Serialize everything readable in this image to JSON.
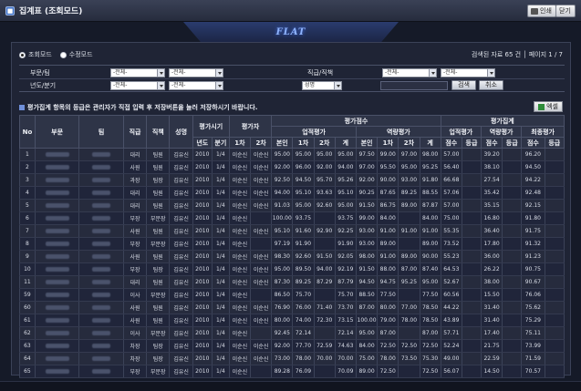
{
  "window": {
    "title": "집계표 (조회모드)",
    "print_label": "인쇄",
    "close_label": "닫기"
  },
  "logo_text": "FLAT",
  "mode": {
    "view_label": "조회모드",
    "edit_label": "수정모드",
    "selected": "view"
  },
  "paging": {
    "text": "검색된 자료 65 건 │ 페이지 1 / 7"
  },
  "filters": {
    "dept_label": "부문/팀",
    "dept_value": "-전체-",
    "team_value": "-전체-",
    "rank_label": "직급/직책",
    "rank_value": "-전체-",
    "position_value": "-전체-",
    "year_label": "년도/분기",
    "year_value": "-전체-",
    "quarter_value": "-전체-",
    "name_value": "성명",
    "search_label": "검색",
    "cancel_label": "취소"
  },
  "notice": "평가집계 항목의 등급은 관리자가 직접 입력 후 저장버튼을 눌러 저장하시기 바랍니다.",
  "excel_label": "엑셀",
  "table": {
    "headers": {
      "no": "No",
      "dept": "부문",
      "team": "팀",
      "rank": "직급",
      "position": "직책",
      "name": "성명",
      "period": "평가시기",
      "evaluator": "평가자",
      "score": "평가점수",
      "summary": "평가집계",
      "year": "년도",
      "quarter": "분기",
      "first": "1차",
      "second": "2차",
      "perf": "업적평가",
      "comp": "역량평가",
      "self": "본인",
      "p1": "1차",
      "p2": "2차",
      "total": "계",
      "perf_sum": "업적평가",
      "comp_sum": "역량평가",
      "final": "최종평가",
      "pts": "점수",
      "grade": "등급"
    },
    "rows": [
      [
        "1",
        "대리",
        "팀원",
        "김유신",
        "2010",
        "1/4",
        "이순신",
        "이순신",
        "95.00",
        "95.00",
        "95.00",
        "95.00",
        "97.50",
        "99.00",
        "97.00",
        "98.00",
        "57.00",
        "",
        "39.20",
        "",
        "96.20",
        ""
      ],
      [
        "2",
        "사원",
        "팀원",
        "김유신",
        "2010",
        "1/4",
        "이순신",
        "이순신",
        "92.00",
        "96.00",
        "92.00",
        "94.00",
        "97.00",
        "95.50",
        "95.00",
        "95.25",
        "56.40",
        "",
        "38.10",
        "",
        "94.50",
        ""
      ],
      [
        "3",
        "과장",
        "팀장",
        "김유신",
        "2010",
        "1/4",
        "이순신",
        "이순신",
        "92.50",
        "94.50",
        "95.70",
        "95.26",
        "92.00",
        "90.00",
        "93.00",
        "91.80",
        "66.68",
        "",
        "27.54",
        "",
        "94.22",
        ""
      ],
      [
        "4",
        "대리",
        "팀원",
        "김유신",
        "2010",
        "1/4",
        "이순신",
        "이순신",
        "94.00",
        "95.10",
        "93.63",
        "95.10",
        "90.25",
        "87.65",
        "89.25",
        "88.55",
        "57.06",
        "",
        "35.42",
        "",
        "92.48",
        ""
      ],
      [
        "5",
        "대리",
        "팀원",
        "김유신",
        "2010",
        "1/4",
        "이순신",
        "이순신",
        "91.03",
        "95.00",
        "92.60",
        "95.00",
        "91.50",
        "86.75",
        "89.00",
        "87.87",
        "57.00",
        "",
        "35.15",
        "",
        "92.15",
        ""
      ],
      [
        "6",
        "부장",
        "부문장",
        "김유신",
        "2010",
        "1/4",
        "이순신",
        "",
        "100.00",
        "93.75",
        "",
        "93.75",
        "99.00",
        "84.00",
        "",
        "84.00",
        "75.00",
        "",
        "16.80",
        "",
        "91.80",
        ""
      ],
      [
        "7",
        "사원",
        "팀원",
        "김유신",
        "2010",
        "1/4",
        "이순신",
        "이순신",
        "95.10",
        "91.60",
        "92.90",
        "92.25",
        "93.00",
        "91.00",
        "91.00",
        "91.00",
        "55.35",
        "",
        "36.40",
        "",
        "91.75",
        ""
      ],
      [
        "8",
        "부장",
        "부문장",
        "김유신",
        "2010",
        "1/4",
        "이순신",
        "",
        "97.19",
        "91.90",
        "",
        "91.90",
        "93.00",
        "89.00",
        "",
        "89.00",
        "73.52",
        "",
        "17.80",
        "",
        "91.32",
        ""
      ],
      [
        "9",
        "사원",
        "팀원",
        "김유신",
        "2010",
        "1/4",
        "이순신",
        "이순신",
        "98.30",
        "92.60",
        "91.50",
        "92.05",
        "98.00",
        "91.00",
        "89.00",
        "90.00",
        "55.23",
        "",
        "36.00",
        "",
        "91.23",
        ""
      ],
      [
        "10",
        "부장",
        "팀장",
        "김유신",
        "2010",
        "1/4",
        "이순신",
        "이순신",
        "95.00",
        "89.50",
        "94.00",
        "92.19",
        "91.50",
        "88.00",
        "87.00",
        "87.40",
        "64.53",
        "",
        "26.22",
        "",
        "90.75",
        ""
      ],
      [
        "11",
        "대리",
        "팀원",
        "김유신",
        "2010",
        "1/4",
        "이순신",
        "이순신",
        "87.30",
        "89.25",
        "87.29",
        "87.79",
        "94.50",
        "94.75",
        "95.25",
        "95.00",
        "52.67",
        "",
        "38.00",
        "",
        "90.67",
        ""
      ],
      [
        "59",
        "이사",
        "부문장",
        "김유신",
        "2010",
        "1/4",
        "이순신",
        "",
        "86.50",
        "75.70",
        "",
        "75.70",
        "88.50",
        "77.50",
        "",
        "77.50",
        "60.56",
        "",
        "15.50",
        "",
        "76.06",
        ""
      ],
      [
        "60",
        "사원",
        "팀원",
        "김유신",
        "2010",
        "1/4",
        "이순신",
        "이순신",
        "76.90",
        "76.00",
        "71.40",
        "73.70",
        "87.00",
        "80.00",
        "77.00",
        "78.50",
        "44.22",
        "",
        "31.40",
        "",
        "75.62",
        ""
      ],
      [
        "61",
        "사원",
        "팀원",
        "김유신",
        "2010",
        "1/4",
        "이순신",
        "이순신",
        "80.00",
        "74.00",
        "72.30",
        "73.15",
        "100.00",
        "79.00",
        "78.00",
        "78.50",
        "43.89",
        "",
        "31.40",
        "",
        "75.29",
        ""
      ],
      [
        "62",
        "이사",
        "부문장",
        "김유신",
        "2010",
        "1/4",
        "이순신",
        "",
        "92.45",
        "72.14",
        "",
        "72.14",
        "95.00",
        "87.00",
        "",
        "87.00",
        "57.71",
        "",
        "17.40",
        "",
        "75.11",
        ""
      ],
      [
        "63",
        "차장",
        "팀장",
        "김유신",
        "2010",
        "1/4",
        "이순신",
        "이순신",
        "92.00",
        "77.70",
        "72.59",
        "74.63",
        "84.00",
        "72.50",
        "72.50",
        "72.50",
        "52.24",
        "",
        "21.75",
        "",
        "73.99",
        ""
      ],
      [
        "64",
        "차장",
        "팀장",
        "김유신",
        "2010",
        "1/4",
        "이순신",
        "이순신",
        "73.00",
        "78.00",
        "70.00",
        "70.00",
        "75.00",
        "78.00",
        "73.50",
        "75.30",
        "49.00",
        "",
        "22.59",
        "",
        "71.59",
        ""
      ],
      [
        "65",
        "부장",
        "부문장",
        "김유신",
        "2010",
        "1/4",
        "이순신",
        "",
        "89.28",
        "76.09",
        "",
        "70.09",
        "89.00",
        "72.50",
        "",
        "72.50",
        "56.07",
        "",
        "14.50",
        "",
        "70.57",
        ""
      ]
    ]
  },
  "colors": {
    "background": "#151a28",
    "panel": "#1f2435",
    "header": "#2e3447",
    "accent": "#3b6fc4"
  },
  "icons": {
    "title": "app-icon",
    "print": "printer-icon",
    "close": "close-icon",
    "excel": "excel-icon",
    "notice": "info-icon"
  }
}
